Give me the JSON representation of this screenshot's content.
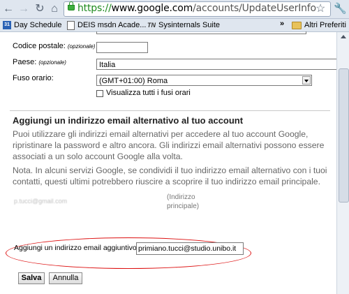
{
  "browser": {
    "url_scheme": "https://",
    "url_host": "www.google.com",
    "url_path": "/accounts/UpdateUserInfo",
    "icons": [
      "back-icon",
      "forward-icon",
      "reload-icon",
      "home-icon",
      "lock-icon",
      "star-icon",
      "wrench-icon"
    ]
  },
  "bookmarks": {
    "items": [
      "Day Schedule",
      "DEIS msdn Acade...",
      "Sysinternals Suite"
    ],
    "calendar_icon_text": "31",
    "tn_icon_text": "TN",
    "overflow": "»",
    "other_label": "Altri Preferiti"
  },
  "form": {
    "postal_label": "Codice postale:",
    "postal_optional": "(opzionale)",
    "postal_value": "",
    "country_label": "Paese:",
    "country_optional": "(opzionale)",
    "country_value": "Italia",
    "timezone_label": "Fuso orario:",
    "timezone_value": "(GMT+01:00) Roma",
    "show_all_tz_label": "Visualizza tutti i fusi orari",
    "show_all_tz_checked": false
  },
  "alt_email": {
    "title": "Aggiungi un indirizzo email alternativo al tuo account",
    "para1_lines": [
      "Puoi utilizzare gli indirizzi email alternativi per accedere al tuo account Google,",
      "ripristinare la password e altro ancora. Gli indirizzi email alternativi possono essere",
      "associati a un solo account Google alla volta."
    ],
    "para2_lines": [
      "Nota. In alcuni servizi Google, se condividi il tuo indirizzo email alternativo con i tuoi",
      "contatti, questi ultimi potrebbero riuscire a scoprire il tuo indirizzo email principale."
    ],
    "primary_email": "p.tucci@gmail.com",
    "primary_note_lines": [
      "(Indirizzo",
      "principale)"
    ],
    "add_label": "Aggiungi un indirizzo email aggiuntivo:",
    "add_value": "primiano.tucci@studio.unibo.it"
  },
  "actions": {
    "save_label": "Salva",
    "cancel_label": "Annulla"
  },
  "colors": {
    "highlight": "#dd1111",
    "url_secure": "#1d8a1d"
  }
}
